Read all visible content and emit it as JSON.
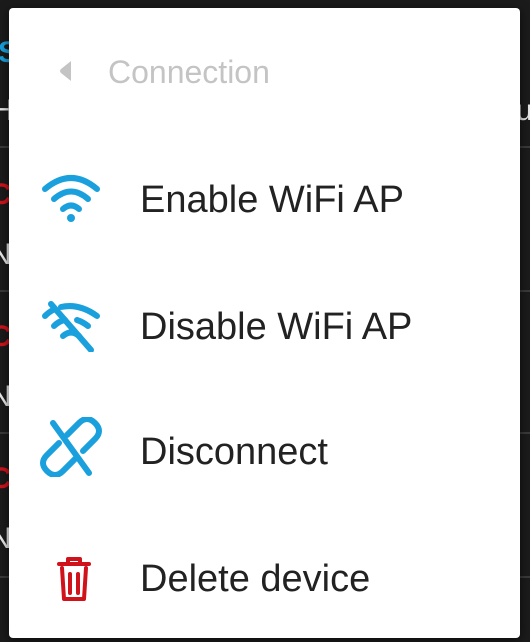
{
  "background": {
    "fragments": [
      "S",
      "H",
      "u",
      "C",
      "N",
      "C",
      "N",
      "C",
      "N"
    ]
  },
  "menu": {
    "header": {
      "icon": "back-arrow-icon",
      "label": "Connection"
    },
    "items": [
      {
        "label": "Enable WiFi AP",
        "icon": "wifi-icon"
      },
      {
        "label": "Disable WiFi AP",
        "icon": "wifi-off-icon"
      },
      {
        "label": "Disconnect",
        "icon": "link-off-icon"
      },
      {
        "label": "Delete device",
        "icon": "trash-icon"
      }
    ]
  },
  "colors": {
    "accent": "#1aa0dc",
    "danger": "#d0121b",
    "header_text": "#c4c4c4",
    "item_text": "#222222"
  }
}
